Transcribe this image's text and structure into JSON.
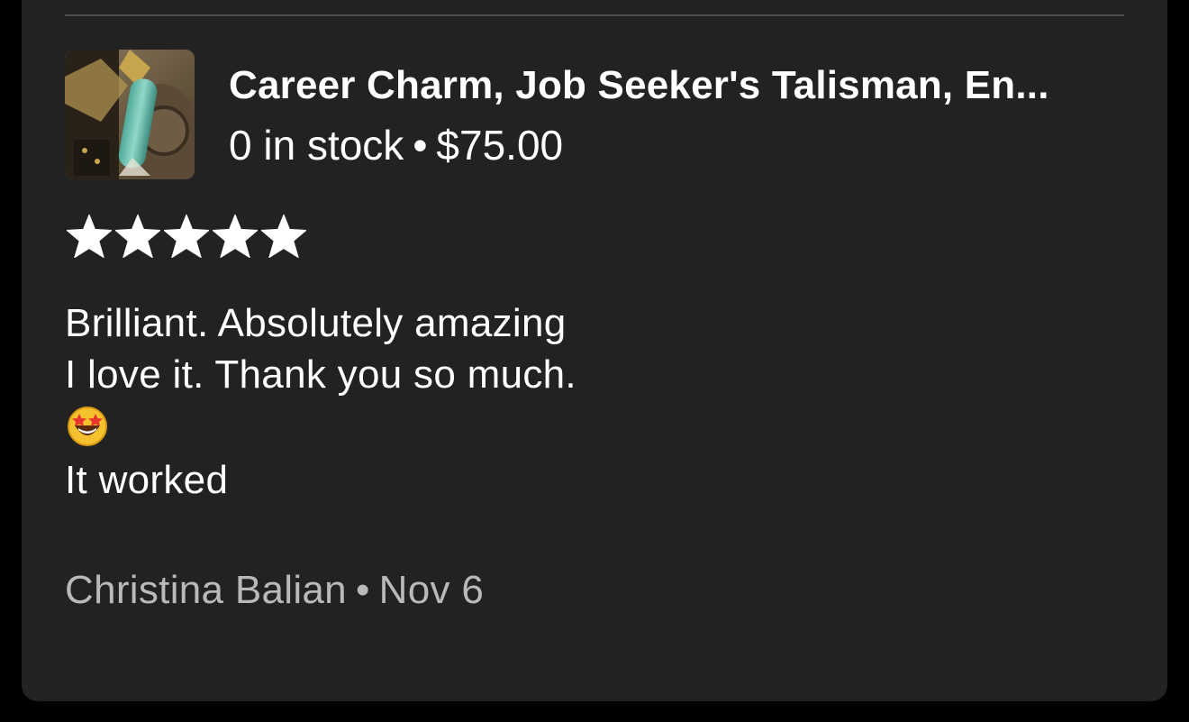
{
  "listing": {
    "title": "Career Charm, Job Seeker's Talisman, En...",
    "stock": "0 in stock",
    "separator": "•",
    "price": "$75.00",
    "image_icon": "product-thumbnail"
  },
  "review": {
    "rating": 5,
    "rating_max": 5,
    "lines": [
      "Brilliant. Absolutely amazing",
      "I love it. Thank you so much.",
      "It worked"
    ],
    "emoji": "star-struck-emoji",
    "author": "Christina Balian",
    "separator": "•",
    "date": "Nov 6"
  },
  "colors": {
    "background": "#000000",
    "card": "#222222",
    "divider": "#4c4c4c",
    "text_primary": "#ffffff",
    "text_secondary": "#b9b9b9",
    "star": "#ffffff"
  }
}
